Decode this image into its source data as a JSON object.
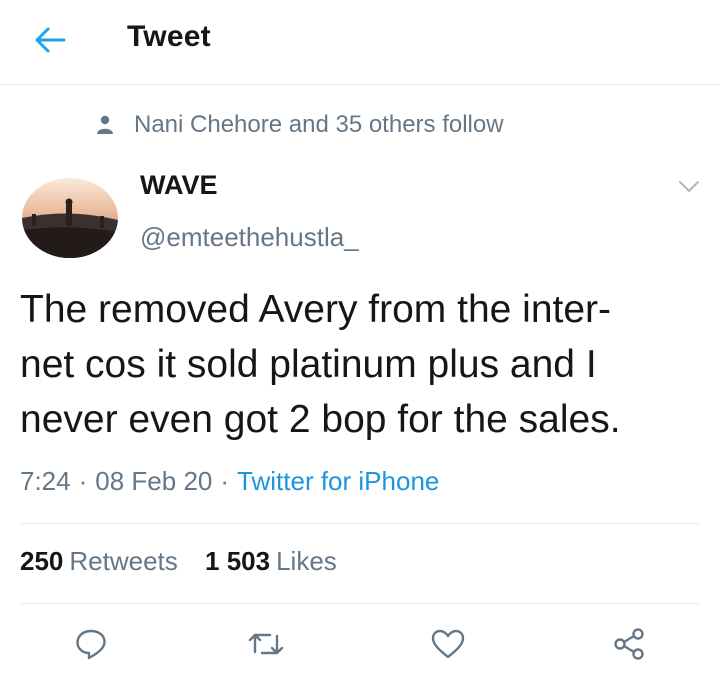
{
  "header": {
    "title": "Tweet",
    "back_icon": "back-arrow-icon",
    "accent_color": "#1da1f2"
  },
  "social_context": {
    "icon": "person-icon",
    "text": "Nani Chehore and 35 others follow"
  },
  "author": {
    "name": "WAVE",
    "handle": "@emteethehustla_"
  },
  "tweet": {
    "lines": [
      "The removed Avery from the inter-",
      "net cos it sold platinum plus and I",
      "never even got 2 bop for the sales."
    ]
  },
  "meta": {
    "time": "7:24",
    "separator": "·",
    "date": "08 Feb 20",
    "source": "Twitter for iPhone"
  },
  "stats": {
    "retweets": {
      "count": "250",
      "label": "Retweets"
    },
    "likes": {
      "count": "1 503",
      "label": "Likes"
    }
  },
  "actions": [
    "reply-icon",
    "retweet-icon",
    "like-icon",
    "share-icon"
  ],
  "colors": {
    "text": "#14171a",
    "secondary": "#657786",
    "link": "#1b95e0",
    "divider": "#e6ecf0"
  }
}
